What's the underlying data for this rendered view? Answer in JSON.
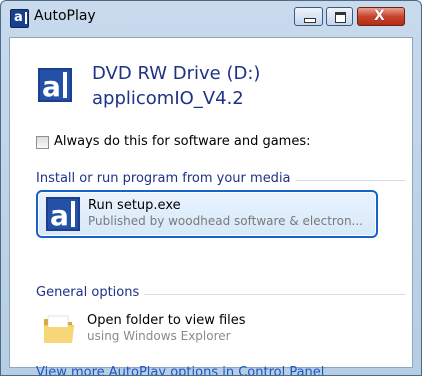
{
  "window": {
    "title": "AutoPlay",
    "icon": "applicom-a-icon"
  },
  "controls": {
    "minimize_icon": "minimize-icon",
    "maximize_icon": "maximize-icon",
    "close_icon": "close-icon",
    "close_glyph": "X"
  },
  "device": {
    "name": "DVD RW Drive (D:)",
    "label": "applicomIO_V4.2",
    "icon": "applicom-a-icon"
  },
  "always": {
    "label": "Always do this for software and games:",
    "checked": false
  },
  "sections": {
    "install": "Install or run program from your media",
    "general": "General options"
  },
  "run_item": {
    "title": "Run setup.exe",
    "subtitle": "Published by woodhead software & electron...",
    "icon": "applicom-a-icon"
  },
  "folder_item": {
    "title": "Open folder to view files",
    "subtitle": "using Windows Explorer",
    "icon": "folder-icon"
  },
  "link": "View more AutoPlay options in Control Panel",
  "colors": {
    "heading_blue": "#1e3287",
    "link_blue": "#1a56c4",
    "selection_border": "#1763c7",
    "close_red": "#c7442d"
  }
}
